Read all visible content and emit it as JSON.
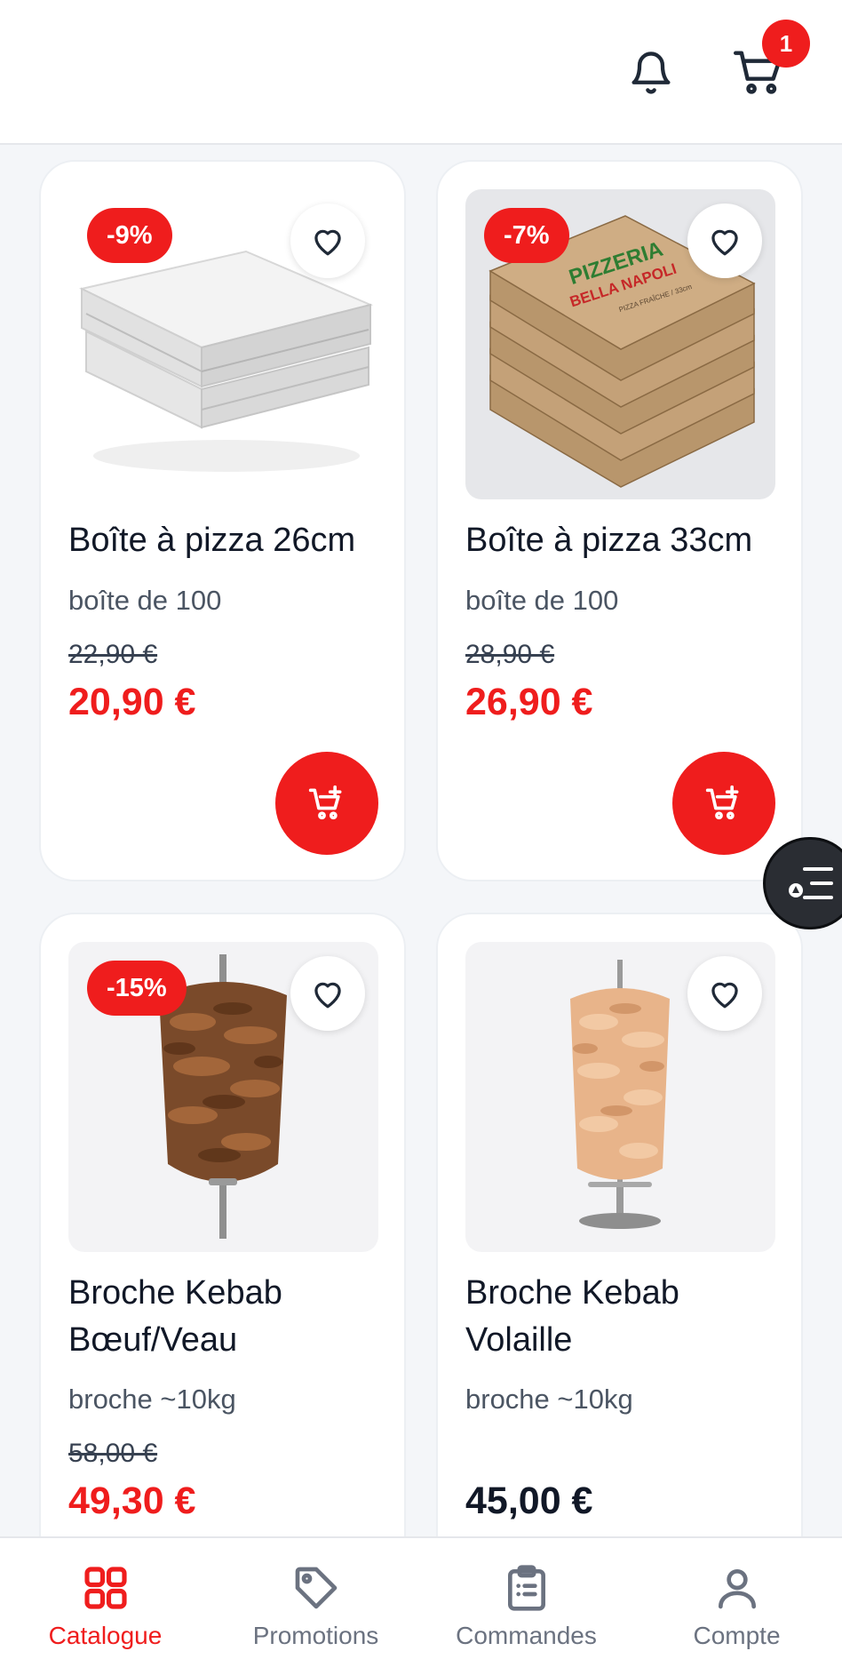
{
  "header": {
    "notification_count": "1"
  },
  "products": [
    {
      "name": "Boîte à pizza 26cm",
      "unit": "boîte de 100",
      "old_price": "22,90 €",
      "price": "20,90 €",
      "discount": "-9%"
    },
    {
      "name": "Boîte à pizza 33cm",
      "unit": "boîte de 100",
      "old_price": "28,90 €",
      "price": "26,90 €",
      "discount": "-7%",
      "box_print": {
        "brand_line1": "PIZZERIA",
        "brand_line2": "BELLA NAPOLI",
        "subline": "PIZZA FRAÎCHE / 33cm"
      }
    },
    {
      "name": "Broche Kebab Bœuf/Veau",
      "unit": "broche ~10kg",
      "old_price": "58,00 €",
      "price": "49,30 €",
      "discount": "-15%"
    },
    {
      "name": "Broche Kebab Volaille",
      "unit": "broche ~10kg",
      "price": "45,00 €"
    }
  ],
  "nav": [
    {
      "label": "Catalogue",
      "icon": "grid-icon",
      "active": true
    },
    {
      "label": "Promotions",
      "icon": "tag-icon"
    },
    {
      "label": "Commandes",
      "icon": "clipboard-icon"
    },
    {
      "label": "Compte",
      "icon": "user-icon"
    }
  ],
  "colors": {
    "accent": "#ef1d1d",
    "text": "#111827",
    "muted": "#4b5563",
    "background": "#f4f6f9"
  }
}
